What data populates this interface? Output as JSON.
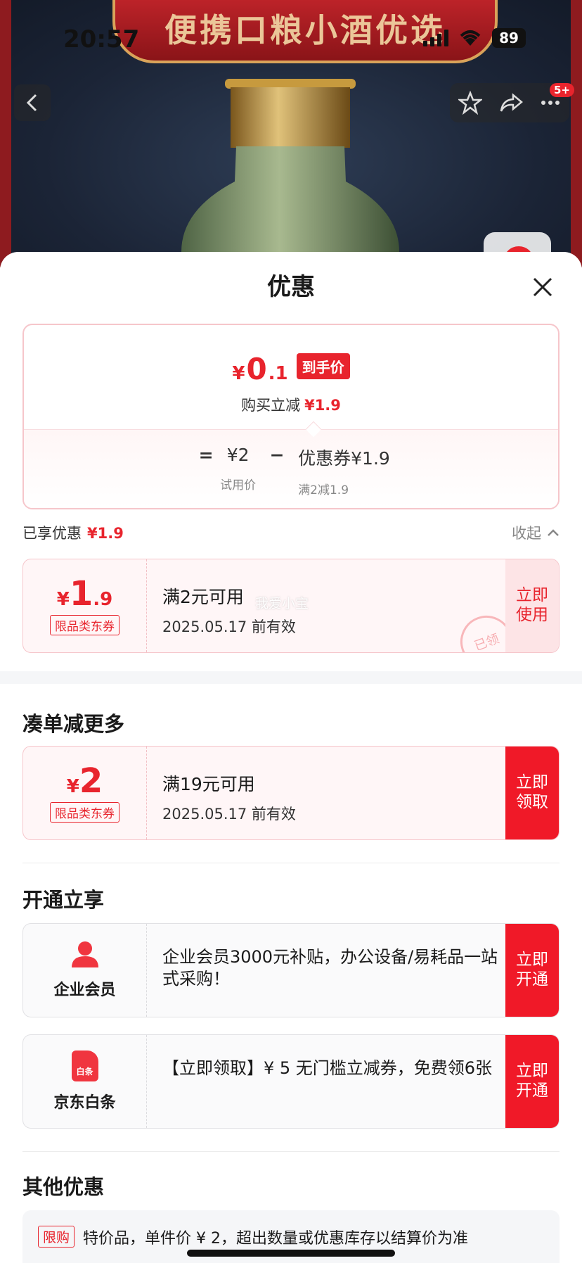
{
  "status_bar": {
    "time": "20:57",
    "battery": "89"
  },
  "banner": {
    "text": "便携口粮小酒优选"
  },
  "nav": {
    "badge": "5+"
  },
  "sheet": {
    "title": "优惠",
    "price": {
      "yen": "¥",
      "integer": "0",
      "decimal": ".1",
      "tag": "到手价",
      "reduce_label": "购买立减",
      "reduce_value": "¥1.9",
      "equals": "=",
      "base_value": "¥2",
      "base_label": "试用价",
      "minus": "−",
      "coupon_value": "优惠券¥1.9",
      "coupon_label": "满2减1.9"
    },
    "enjoyed": {
      "label": "已享优惠",
      "value": "¥1.9",
      "collapse": "收起"
    },
    "coupon_applied": {
      "yen": "¥",
      "integer": "1",
      "decimal": ".9",
      "tag": "限品类东券",
      "condition": "满2元可用",
      "expiry": "2025.05.17 前有效",
      "action": "立即使用",
      "stamp": "已领",
      "watermark": "我爱小宝"
    },
    "more": {
      "title": "凑单减更多",
      "coupon": {
        "yen": "¥",
        "integer": "2",
        "decimal": "",
        "tag": "限品类东券",
        "condition": "满19元可用",
        "expiry": "2025.05.17 前有效",
        "action": "立即领取"
      }
    },
    "open": {
      "title": "开通立享",
      "items": [
        {
          "label": "企业会员",
          "icon": "user-icon",
          "desc": " 企业会员3000元补贴，办公设备/易耗品一站式采购！",
          "action": "立即开通"
        },
        {
          "label": "京东白条",
          "icon": "baitiao-icon",
          "icon_text": "白条",
          "desc": "【立即领取】¥ 5 无门槛立减券，免费领6张",
          "action": "立即开通"
        }
      ]
    },
    "other": {
      "title": "其他优惠",
      "tag": "限购",
      "text": "特价品，单件价 ¥ 2，超出数量或优惠库存以结算价为准"
    }
  },
  "colors": {
    "accent": "#e8242d",
    "button": "#f01928",
    "coupon_bg": "#fff6f7"
  }
}
